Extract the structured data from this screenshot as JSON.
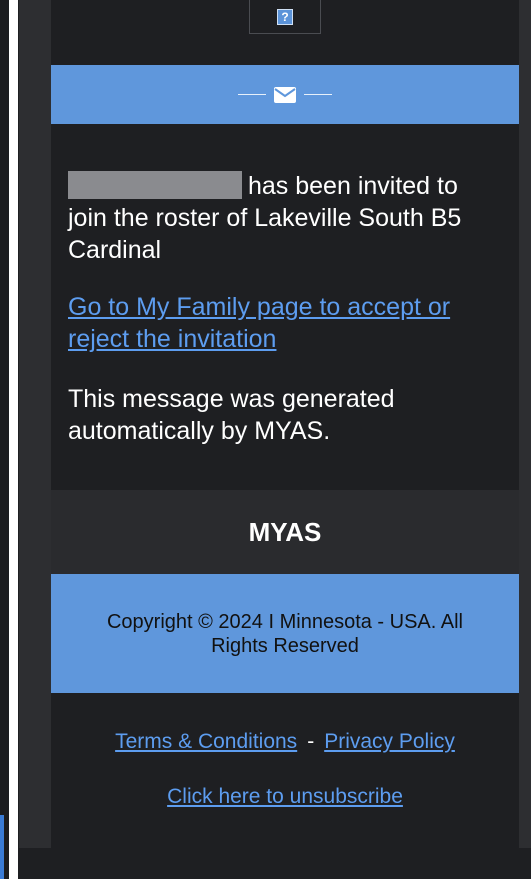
{
  "colors": {
    "accent_blue": "#5f97dc",
    "link_blue": "#5d9df0",
    "dark_bg": "#1e1f22",
    "brand_band": "#2a2b2e"
  },
  "header": {
    "help_icon_label": "?",
    "envelope_icon": "envelope-icon"
  },
  "message": {
    "invite_text": "has been invited to join the roster of Lakeville South B5 Cardinal",
    "action_link": "Go to My Family page to accept or reject the invitation",
    "auto_note": "This message was generated automatically by MYAS."
  },
  "brand": {
    "name": "MYAS"
  },
  "footer": {
    "copyright": "Copyright © 2024 I Minnesota - USA. All Rights Reserved",
    "terms_label": "Terms & Conditions",
    "separator": "-",
    "privacy_label": "Privacy Policy",
    "unsubscribe_label": "Click here to unsubscribe"
  }
}
